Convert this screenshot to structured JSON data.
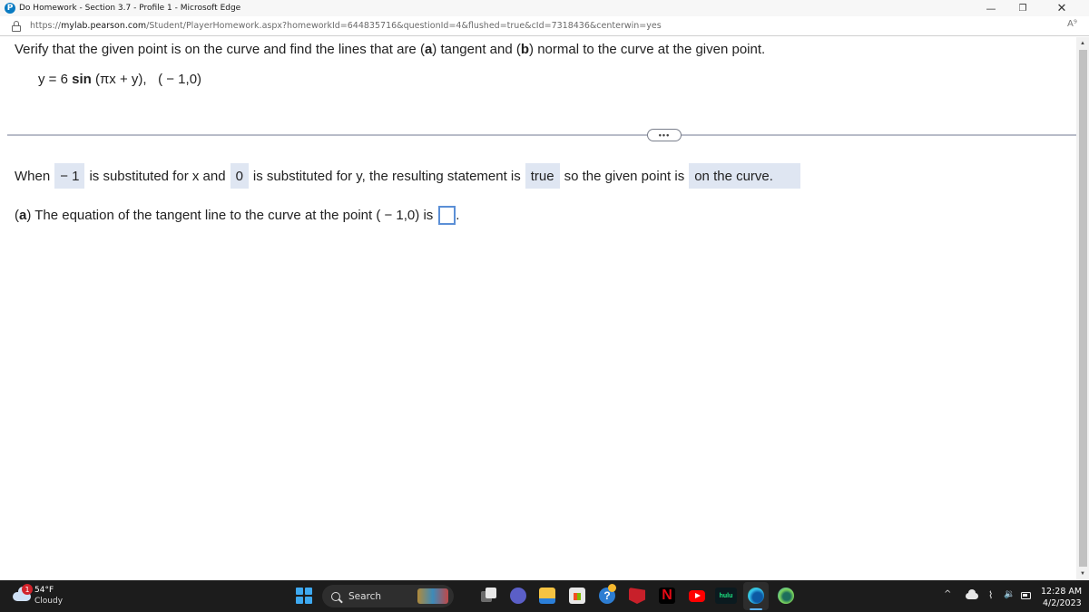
{
  "window": {
    "title": "Do Homework - Section 3.7 - Profile 1 - Microsoft Edge",
    "app_icon_letter": "P",
    "controls": {
      "minimize": "—",
      "maximize": "❐",
      "close": "✕"
    }
  },
  "address_bar": {
    "url_prefix": "https://",
    "url_host": "mylab.pearson.com",
    "url_path": "/Student/PlayerHomework.aspx?homeworkId=644835716&questionId=4&flushed=true&cId=7318436&centerwin=yes",
    "read_aloud_glyph": "A⁹"
  },
  "problem": {
    "instruction_parts": [
      "Verify that the given point is on the curve and find the lines that are (",
      "a",
      ") tangent and (",
      "b",
      ") normal to the curve at the given point."
    ],
    "equation_lhs": "y = 6 ",
    "equation_fn": "sin",
    "equation_rhs": " (πx + y),",
    "point": "( − 1,0)",
    "more_button": "•••"
  },
  "verification": {
    "text_1": "When",
    "x_value": "− 1",
    "text_2": "is substituted for x and",
    "y_value": "0",
    "text_3": "is substituted for y, the resulting statement is",
    "statement_value": "true",
    "text_4": "so the given point is",
    "conclusion_value": "on the curve."
  },
  "part_a": {
    "label": "a",
    "text": ") The equation of the tangent line to the curve at the point ( − 1,0) is",
    "input_value": "",
    "trailing": "."
  },
  "taskbar": {
    "weather": {
      "badge": "1",
      "temperature": "54°F",
      "condition": "Cloudy"
    },
    "search_label": "Search",
    "apps": [
      "task-view",
      "teams-chat",
      "file-explorer",
      "microsoft-store",
      "get-help",
      "mcafee",
      "netflix",
      "youtube",
      "hulu",
      "microsoft-edge",
      "edge-dev"
    ],
    "tray": {
      "chevron": "^",
      "wifi": "⌇",
      "volume": "🔉"
    },
    "clock": {
      "time": "12:28 AM",
      "date": "4/2/2023"
    },
    "netflix_letter": "N",
    "hulu_label": "hulu",
    "help_glyph": "?"
  }
}
